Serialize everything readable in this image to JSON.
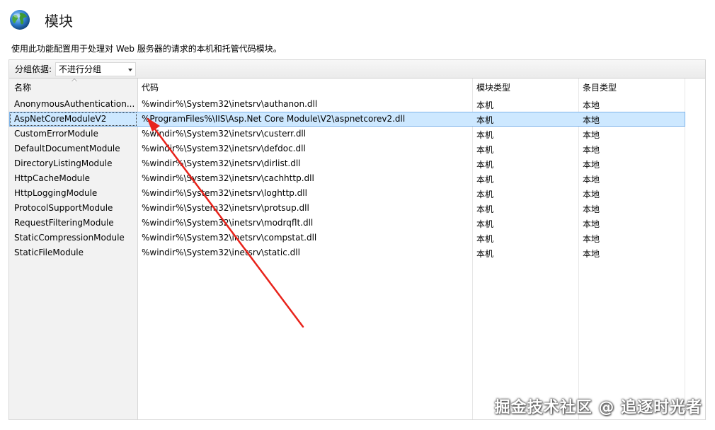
{
  "page": {
    "title": "模块",
    "description": "使用此功能配置用于处理对 Web 服务器的请求的本机和托管代码模块。",
    "icon": "globe-icon"
  },
  "toolbar": {
    "group_label": "分组依据:",
    "group_value": "不进行分组"
  },
  "table": {
    "columns": [
      "名称",
      "代码",
      "模块类型",
      "条目类型"
    ],
    "rows": [
      {
        "name": "AnonymousAuthentication...",
        "code": "%windir%\\System32\\inetsrv\\authanon.dll",
        "module_type": "本机",
        "entry_type": "本地"
      },
      {
        "name": "AspNetCoreModuleV2",
        "code": "%ProgramFiles%\\IIS\\Asp.Net Core Module\\V2\\aspnetcorev2.dll",
        "module_type": "本机",
        "entry_type": "本地"
      },
      {
        "name": "CustomErrorModule",
        "code": "%windir%\\System32\\inetsrv\\custerr.dll",
        "module_type": "本机",
        "entry_type": "本地"
      },
      {
        "name": "DefaultDocumentModule",
        "code": "%windir%\\System32\\inetsrv\\defdoc.dll",
        "module_type": "本机",
        "entry_type": "本地"
      },
      {
        "name": "DirectoryListingModule",
        "code": "%windir%\\System32\\inetsrv\\dirlist.dll",
        "module_type": "本机",
        "entry_type": "本地"
      },
      {
        "name": "HttpCacheModule",
        "code": "%windir%\\System32\\inetsrv\\cachhttp.dll",
        "module_type": "本机",
        "entry_type": "本地"
      },
      {
        "name": "HttpLoggingModule",
        "code": "%windir%\\System32\\inetsrv\\loghttp.dll",
        "module_type": "本机",
        "entry_type": "本地"
      },
      {
        "name": "ProtocolSupportModule",
        "code": "%windir%\\System32\\inetsrv\\protsup.dll",
        "module_type": "本机",
        "entry_type": "本地"
      },
      {
        "name": "RequestFilteringModule",
        "code": "%windir%\\System32\\inetsrv\\modrqflt.dll",
        "module_type": "本机",
        "entry_type": "本地"
      },
      {
        "name": "StaticCompressionModule",
        "code": "%windir%\\System32\\inetsrv\\compstat.dll",
        "module_type": "本机",
        "entry_type": "本地"
      },
      {
        "name": "StaticFileModule",
        "code": "%windir%\\System32\\inetsrv\\static.dll",
        "module_type": "本机",
        "entry_type": "本地"
      }
    ],
    "selected_index": 1
  },
  "annotation": {
    "color": "#e8231b"
  },
  "watermark": {
    "text": "掘金技术社区 @ 追逐时光者"
  }
}
